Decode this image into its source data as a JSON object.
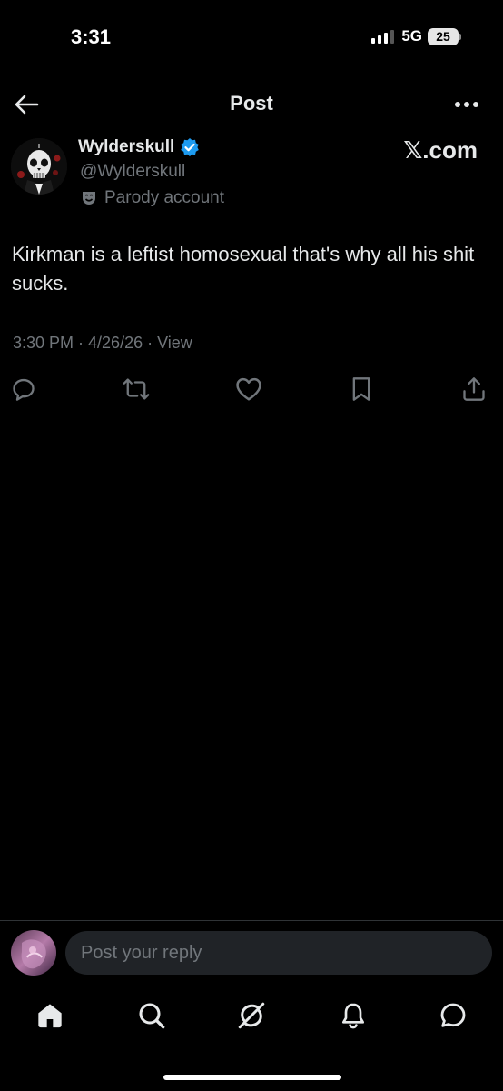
{
  "status_bar": {
    "time": "3:31",
    "network": "5G",
    "battery": "25"
  },
  "header": {
    "title": "Post"
  },
  "author": {
    "name": "Wylderskull",
    "handle": "@Wylderskull",
    "label": "Parody account",
    "verified_color": "#1d9bf0"
  },
  "watermark": "𝕏.com",
  "post": {
    "text": "Kirkman is a leftist homosexual that's why all his shit sucks.",
    "meta": "3:30 PM · 4/26/26 · View"
  },
  "actions": [
    "reply-icon",
    "repost-icon",
    "like-icon",
    "bookmark-icon",
    "share-icon"
  ],
  "reply": {
    "placeholder": "Post your reply"
  },
  "tabs": [
    "home-icon",
    "search-icon",
    "grok-icon",
    "notifications-icon",
    "messages-icon"
  ],
  "colors": {
    "background": "#000000",
    "text": "#e7e9ea",
    "secondary": "#71767b",
    "accent": "#1d9bf0"
  }
}
